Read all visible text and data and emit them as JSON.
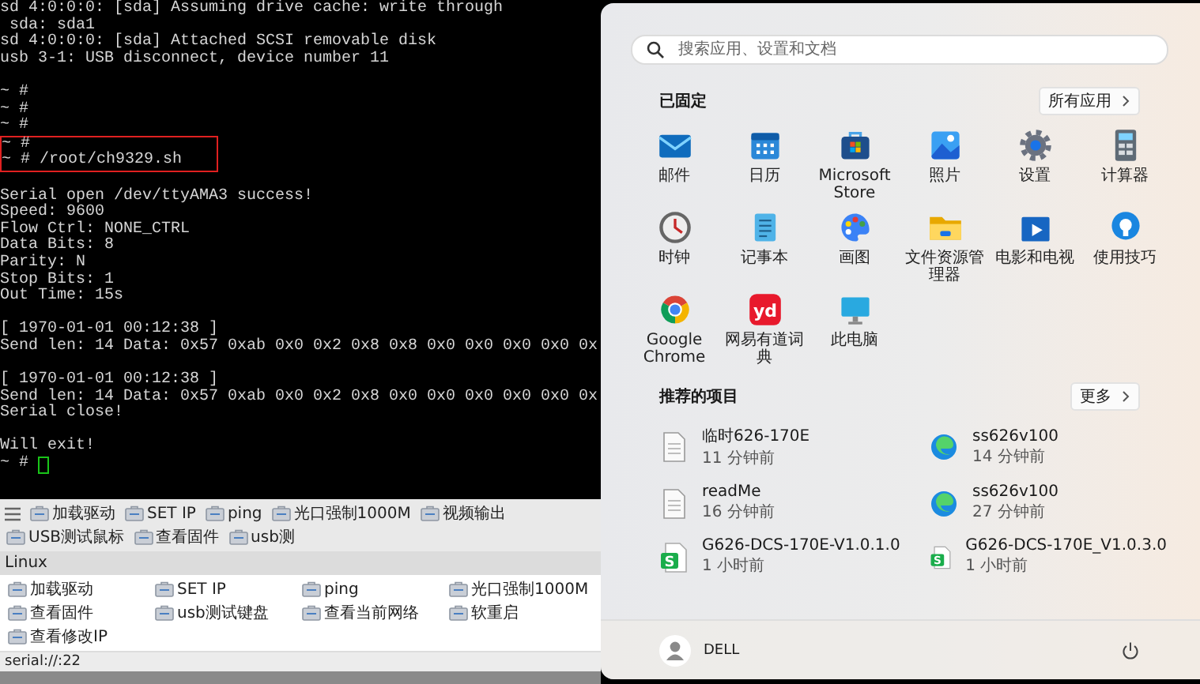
{
  "terminal": {
    "blocks": [
      {
        "lines": [
          "sd 4:0:0:0: [sda] Assuming drive cache: write through",
          " sda: sda1",
          "sd 4:0:0:0: [sda] Attached SCSI removable disk",
          "usb 3-1: USB disconnect, device number 11"
        ],
        "boxed": false,
        "blank_after": true
      },
      {
        "lines": [
          "~ #",
          "~ #",
          "~ #"
        ],
        "boxed": false,
        "blank_after": false
      },
      {
        "lines": [
          "~ #",
          "~ # /root/ch9329.sh"
        ],
        "boxed": true,
        "blank_after": true
      },
      {
        "lines": [
          "Serial open /dev/ttyAMA3 success!",
          "Speed: 9600",
          "Flow Ctrl: NONE_CTRL",
          "Data Bits: 8",
          "Parity: N",
          "Stop Bits: 1",
          "Out Time: 15s"
        ],
        "boxed": false,
        "blank_after": true
      },
      {
        "lines": [
          "[ 1970-01-01 00:12:38 ]",
          "Send len: 14 Data: 0x57 0xab 0x0 0x2 0x8 0x8 0x0 0x0 0x0 0x0 0x"
        ],
        "boxed": false,
        "blank_after": true
      },
      {
        "lines": [
          "[ 1970-01-01 00:12:38 ]",
          "Send len: 14 Data: 0x57 0xab 0x0 0x2 0x8 0x0 0x0 0x0 0x0 0x0 0x",
          "Serial close!"
        ],
        "boxed": false,
        "blank_after": true
      },
      {
        "lines": [
          "Will exit!"
        ],
        "boxed": false,
        "blank_after": false
      }
    ],
    "prompt": "~ #"
  },
  "toolbar": {
    "items": [
      "加载驱动",
      "SET IP",
      "ping",
      "光口强制1000M",
      "视频输出",
      "USB测试鼠标",
      "查看固件",
      "usb测"
    ]
  },
  "command_group": {
    "title": "Linux",
    "items": [
      "加载驱动",
      "SET IP",
      "ping",
      "光口强制1000M",
      "查看固件",
      "usb测试键盘",
      "查看当前网络",
      "软重启",
      "查看修改IP"
    ]
  },
  "status_bar": "serial://:22",
  "start_menu": {
    "search": {
      "placeholder": "搜索应用、设置和文档"
    },
    "pinned": {
      "title": "已固定",
      "button": "所有应用",
      "apps": [
        {
          "label": "邮件"
        },
        {
          "label": "日历"
        },
        {
          "label": "Microsoft Store"
        },
        {
          "label": "照片"
        },
        {
          "label": "设置"
        },
        {
          "label": "计算器"
        },
        {
          "label": "时钟"
        },
        {
          "label": "记事本"
        },
        {
          "label": "画图"
        },
        {
          "label": "文件资源管理器"
        },
        {
          "label": "电影和电视"
        },
        {
          "label": "使用技巧"
        },
        {
          "label": "Google Chrome"
        },
        {
          "label": "网易有道词典",
          "logo_text": "yd"
        },
        {
          "label": "此电脑"
        }
      ]
    },
    "recommended": {
      "title": "推荐的项目",
      "button": "更多",
      "items": [
        {
          "name": "临时626-170E",
          "time": "11 分钟前"
        },
        {
          "name": "ss626v100",
          "time": "14 分钟前"
        },
        {
          "name": "readMe",
          "time": "16 分钟前"
        },
        {
          "name": "ss626v100",
          "time": "27 分钟前"
        },
        {
          "name": "G626-DCS-170E-V1.0.1.0",
          "time": "1 小时前",
          "logo_text": "S"
        },
        {
          "name": "G626-DCS-170E_V1.0.3.0",
          "time": "1 小时前",
          "logo_text": "S"
        }
      ]
    },
    "user": "DELL"
  }
}
